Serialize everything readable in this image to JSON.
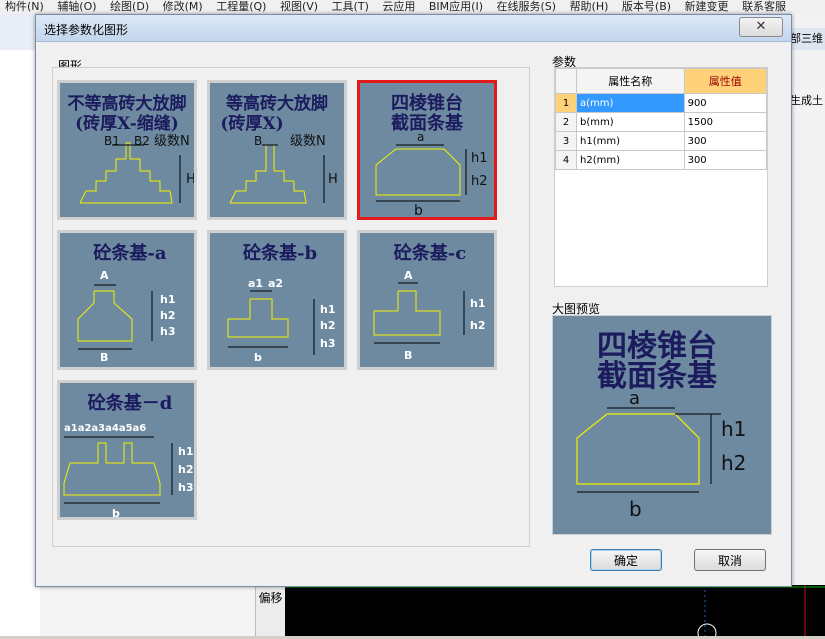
{
  "menu": [
    "构件(N)",
    "辅轴(O)",
    "绘图(D)",
    "修改(M)",
    "工程量(Q)",
    "视图(V)",
    "工具(T)",
    "云应用",
    "BIM应用(I)",
    "在线服务(S)",
    "帮助(H)",
    "版本号(B)",
    "新建变更",
    "联系客服"
  ],
  "bg": {
    "side_tab": "部三维",
    "side_text": "生成土",
    "bottom_tab": "偏移"
  },
  "dialog": {
    "title": "选择参数化图形",
    "close": "✕",
    "gallery_label": "图形",
    "params_label": "参数",
    "preview_label": "大图预览",
    "ok": "确定",
    "cancel": "取消"
  },
  "shapes": [
    {
      "title": "不等高砖大放脚 (砖厚X-缩缝)",
      "line1": "不等高砖大放脚",
      "line2": "(砖厚X-缩缝)",
      "labels": [
        "B1",
        "B2",
        "级数N",
        "H"
      ]
    },
    {
      "title": "等高砖大放脚 (砖厚X)",
      "line1": "等高砖大放脚",
      "line2": "(砖厚X)",
      "labels": [
        "B",
        "级数N",
        "H"
      ]
    },
    {
      "title": "四棱锥台截面条基",
      "line1": "四棱锥台",
      "line2": "截面条基",
      "labels": [
        "a",
        "h1",
        "h2",
        "b"
      ]
    },
    {
      "title": "砼条基-a",
      "labels": [
        "A",
        "h1",
        "h2",
        "h3",
        "B"
      ]
    },
    {
      "title": "砼条基-b",
      "labels": [
        "a1",
        "a2",
        "h1",
        "h2",
        "h3",
        "b"
      ]
    },
    {
      "title": "砼条基-c",
      "labels": [
        "A",
        "h1",
        "h2",
        "B"
      ]
    },
    {
      "title": "砼条基－d",
      "labels": [
        "a1a2a3a4a5a6",
        "h1",
        "h2",
        "h3",
        "b"
      ]
    }
  ],
  "params_table": {
    "headers": [
      "属性名称",
      "属性值"
    ],
    "rows": [
      {
        "no": "1",
        "name": "a(mm)",
        "value": "900"
      },
      {
        "no": "2",
        "name": "b(mm)",
        "value": "1500"
      },
      {
        "no": "3",
        "name": "h1(mm)",
        "value": "300"
      },
      {
        "no": "4",
        "name": "h2(mm)",
        "value": "300"
      }
    ]
  },
  "preview": {
    "line1": "四棱锥台",
    "line2": "截面条基",
    "labels": [
      "a",
      "h1",
      "h2",
      "b"
    ]
  },
  "colors": {
    "tile_bg": "#6d8aa0",
    "selection": "#e31a1a",
    "shape_line": "#f2f200",
    "dim_line": "#000000",
    "title_text": "#1b1b5e"
  }
}
